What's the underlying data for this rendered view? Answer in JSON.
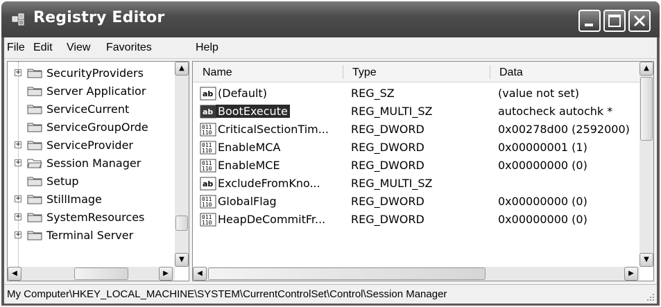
{
  "window": {
    "title": "Registry Editor"
  },
  "menu": [
    "File",
    "Edit",
    "View",
    "Favorites",
    "Help"
  ],
  "tree": {
    "items": [
      {
        "label": "SecurityProviders",
        "expander": "+"
      },
      {
        "label": "Server Applicatior",
        "expander": ""
      },
      {
        "label": "ServiceCurrent",
        "expander": ""
      },
      {
        "label": "ServiceGroupOrde",
        "expander": ""
      },
      {
        "label": "ServiceProvider",
        "expander": "+"
      },
      {
        "label": "Session Manager",
        "expander": "+",
        "open": true
      },
      {
        "label": "Setup",
        "expander": ""
      },
      {
        "label": "StillImage",
        "expander": "+"
      },
      {
        "label": "SystemResources",
        "expander": "+"
      },
      {
        "label": "Terminal Server",
        "expander": "+"
      }
    ]
  },
  "list": {
    "columns": [
      "Name",
      "Type",
      "Data"
    ],
    "rows": [
      {
        "icon": "string-value-icon",
        "name": "(Default)",
        "type": "REG_SZ",
        "data": "(value not set)"
      },
      {
        "icon": "string-value-icon",
        "name": "BootExecute",
        "type": "REG_MULTI_SZ",
        "data": "autocheck autochk *",
        "selected": true
      },
      {
        "icon": "binary-value-icon",
        "name": "CriticalSectionTim...",
        "type": "REG_DWORD",
        "data": "0x00278d00 (2592000)"
      },
      {
        "icon": "binary-value-icon",
        "name": "EnableMCA",
        "type": "REG_DWORD",
        "data": "0x00000001 (1)"
      },
      {
        "icon": "binary-value-icon",
        "name": "EnableMCE",
        "type": "REG_DWORD",
        "data": "0x00000000 (0)"
      },
      {
        "icon": "string-value-icon",
        "name": "ExcludeFromKno...",
        "type": "REG_MULTI_SZ",
        "data": ""
      },
      {
        "icon": "binary-value-icon",
        "name": "GlobalFlag",
        "type": "REG_DWORD",
        "data": "0x00000000 (0)"
      },
      {
        "icon": "binary-value-icon",
        "name": "HeapDeCommitFr...",
        "type": "REG_DWORD",
        "data": "0x00000000 (0)"
      }
    ]
  },
  "status": {
    "path": "My Computer\\HKEY_LOCAL_MACHINE\\SYSTEM\\CurrentControlSet\\Control\\Session Manager"
  }
}
